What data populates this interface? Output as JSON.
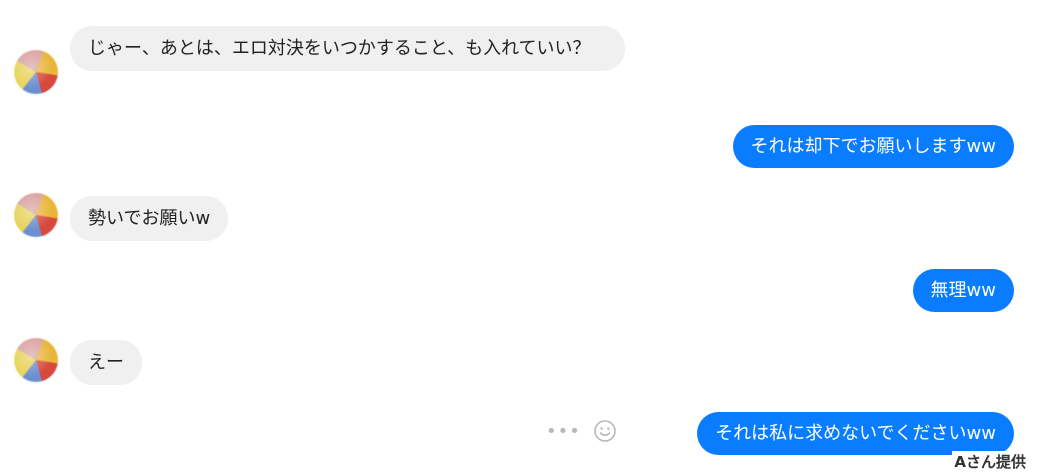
{
  "messages": [
    {
      "side": "incoming",
      "text": "じゃー、あとは、エロ対決をいつかすること、も入れていい？"
    },
    {
      "side": "outgoing",
      "text": "それは却下でお願いしますww"
    },
    {
      "side": "incoming",
      "text": "勢いでお願いw"
    },
    {
      "side": "outgoing",
      "text": "無理ww"
    },
    {
      "side": "incoming",
      "text": "えー"
    },
    {
      "side": "outgoing",
      "text": "それは私に求めないでくださいww"
    }
  ],
  "message_actions": {
    "more_label": "•••",
    "icons": [
      "more-options-icon",
      "emoji-reaction-icon"
    ]
  },
  "colors": {
    "outgoing_bubble": "#0a7cff",
    "incoming_bubble": "#f0f0f0"
  },
  "credit": "Aさん提供"
}
